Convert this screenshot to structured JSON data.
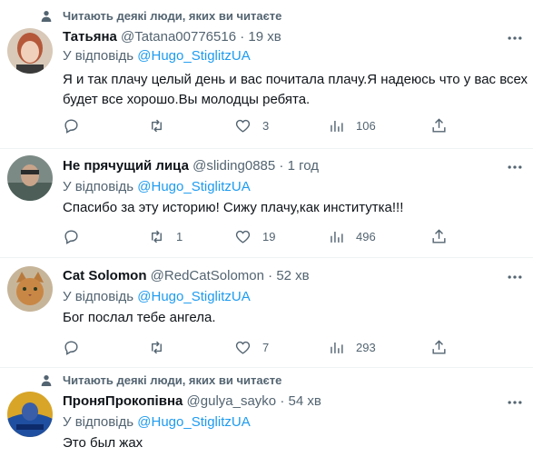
{
  "colors": {
    "text": "#0f1419",
    "secondary": "#536471",
    "link": "#1d9bf0",
    "separator": "#eff3f4"
  },
  "tweets": [
    {
      "name": "Татьяна",
      "handle": "@Tatana00776516",
      "dot": "·",
      "time": "19 хв",
      "reply_prefix": "У відповідь",
      "reply_to": "@Hugo_StiglitzUA",
      "lines": [
        "Я и так плачу целый день и вас почитала плачу.Я надеюсь что у вас всех",
        "будет все хорошо.Вы молодцы ребята."
      ],
      "replies": "",
      "retweets": "",
      "likes": "3",
      "views": "106"
    },
    {
      "name": "Не прячущий лица",
      "handle": "@sliding0885",
      "dot": "·",
      "time": "1 год",
      "reply_prefix": "У відповідь",
      "reply_to": "@Hugo_StiglitzUA",
      "lines": [
        "Спасибо за эту историю! Сижу плачу,как институтка!!!"
      ],
      "replies": "",
      "retweets": "1",
      "likes": "19",
      "views": "496"
    },
    {
      "name": "Cat Solomon",
      "handle": "@RedCatSolomon",
      "dot": "·",
      "time": "52 хв",
      "reply_prefix": "У відповідь",
      "reply_to": "@Hugo_StiglitzUA",
      "lines": [
        "Бог послал тебе ангела."
      ],
      "replies": "",
      "retweets": "",
      "likes": "7",
      "views": "293"
    },
    {
      "name": "ПроняПрокопівна",
      "handle": "@gulya_sayko",
      "dot": "·",
      "time": "54 хв",
      "reply_prefix": "У відповідь",
      "reply_to": "@Hugo_StiglitzUA",
      "lines": [
        "Это был жах"
      ]
    }
  ],
  "social_context": "Читають деякі люди, яких ви читаєте"
}
